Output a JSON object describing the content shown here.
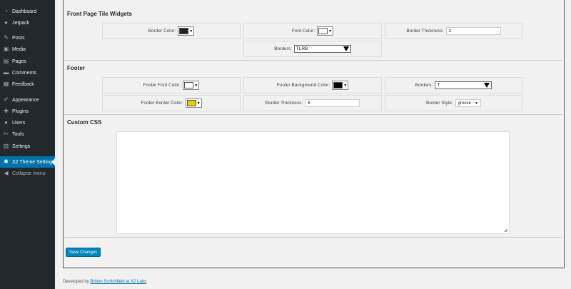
{
  "sidebar": {
    "items": [
      {
        "label": "Dashboard",
        "icon": "dashboard-icon",
        "glyph": "◔"
      },
      {
        "label": "Jetpack",
        "icon": "jetpack-icon",
        "glyph": "●"
      },
      {
        "label": "Posts",
        "icon": "pin-icon",
        "glyph": "✎"
      },
      {
        "label": "Media",
        "icon": "media-icon",
        "glyph": "▣"
      },
      {
        "label": "Pages",
        "icon": "pages-icon",
        "glyph": "▤"
      },
      {
        "label": "Comments",
        "icon": "comments-icon",
        "glyph": "▬"
      },
      {
        "label": "Feedback",
        "icon": "feedback-icon",
        "glyph": "▦"
      },
      {
        "label": "Appearance",
        "icon": "appearance-icon",
        "glyph": "✐"
      },
      {
        "label": "Plugins",
        "icon": "plugins-icon",
        "glyph": "✚"
      },
      {
        "label": "Users",
        "icon": "users-icon",
        "glyph": "●"
      },
      {
        "label": "Tools",
        "icon": "tools-icon",
        "glyph": "✂"
      },
      {
        "label": "Settings",
        "icon": "settings-icon",
        "glyph": "▥"
      },
      {
        "label": "X2 Theme Settings",
        "icon": "gear-icon",
        "glyph": "✱"
      },
      {
        "label": "Collapse menu",
        "icon": "collapse-icon",
        "glyph": "◀"
      }
    ]
  },
  "front_page": {
    "title": "Front Page Tile Widgets",
    "border_color_label": "Border Color:",
    "border_color": "#222222",
    "font_color_label": "Font Color:",
    "font_color": "#ffffff",
    "border_thickness_label": "Border Thickness:",
    "border_thickness": "2",
    "borders_label": "Borders:",
    "borders_value": "TLRB"
  },
  "footer_section": {
    "title": "Footer",
    "font_color_label": "Footer Font Color:",
    "font_color": "#ffffff",
    "bg_color_label": "Footer Background Color:",
    "bg_color": "#000000",
    "borders_label": "Borders:",
    "borders_value": "T",
    "border_color_label": "Footer Border Color:",
    "border_color": "#e8d000",
    "border_thickness_label": "Border Thickness:",
    "border_thickness": "6",
    "border_style_label": "Border Style:",
    "border_style": "groove"
  },
  "custom_css": {
    "title": "Custom CSS",
    "value": ""
  },
  "save_label": "Save Changes",
  "page_footer": {
    "prefix": "Developed by ",
    "link": "Britton Scritchfield at X2 Labs"
  },
  "colors": {
    "accent": "#0073aa",
    "sidebar_bg": "#23282d"
  }
}
